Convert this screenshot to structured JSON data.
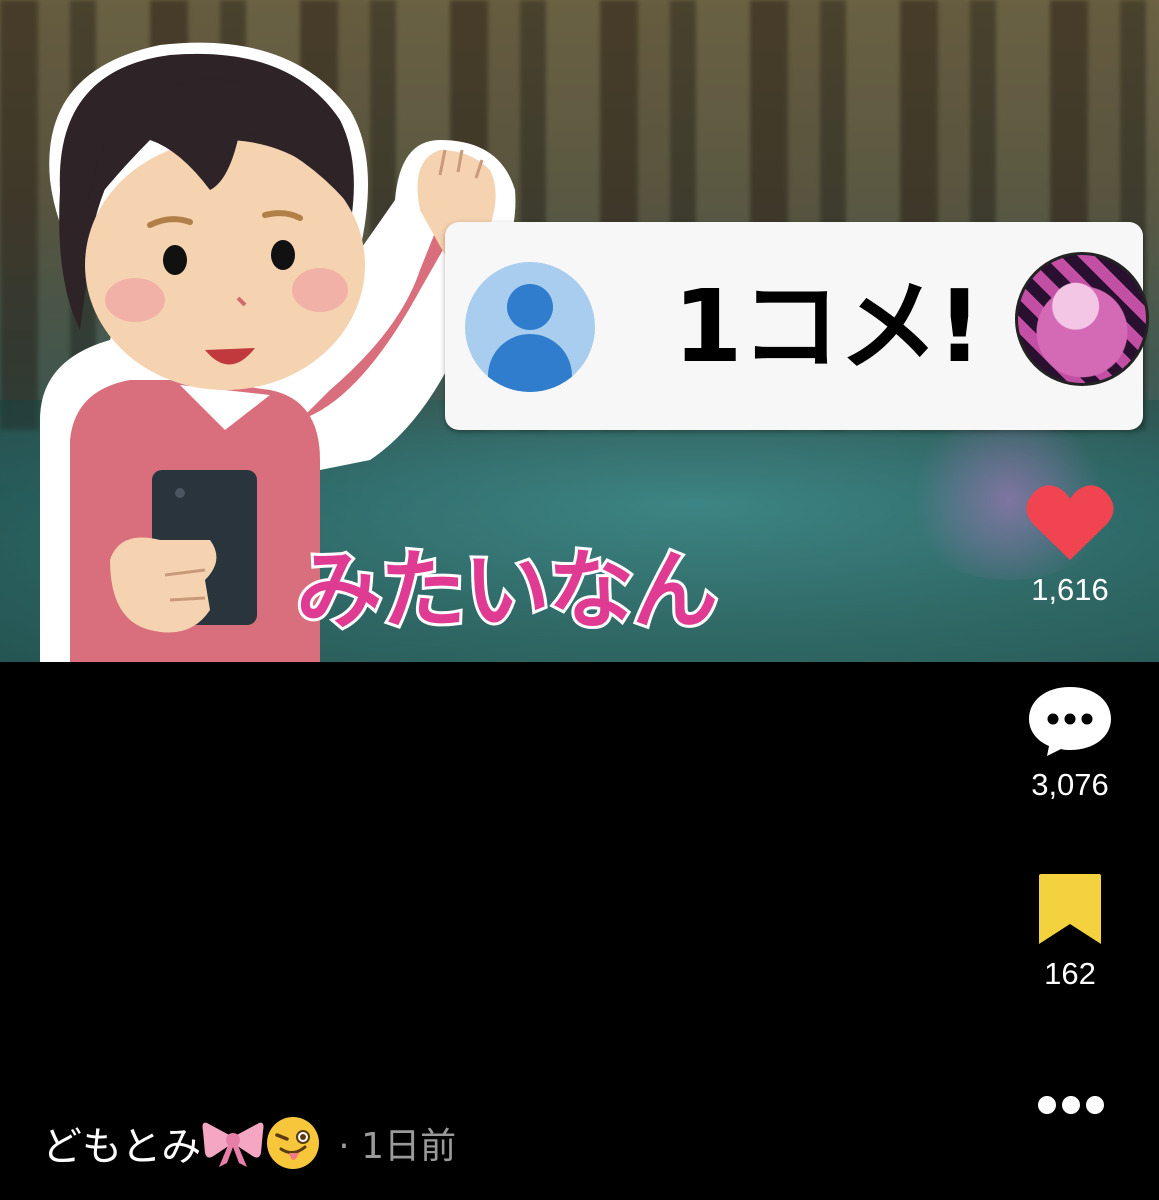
{
  "overlay": {
    "comment_text": "1コメ!",
    "caption": "みたいなん"
  },
  "actions": {
    "likes": "1,616",
    "comments": "3,076",
    "saves": "162"
  },
  "post": {
    "author": "どもとみ",
    "time": "· 1日前"
  },
  "colors": {
    "like": "#f04450",
    "save": "#f4d23f",
    "caption_pink": "#e03b92"
  },
  "icons": [
    "heart-icon",
    "comment-bubble-icon",
    "bookmark-icon",
    "more-dots-icon",
    "ribbon-icon",
    "winking-face-icon"
  ]
}
